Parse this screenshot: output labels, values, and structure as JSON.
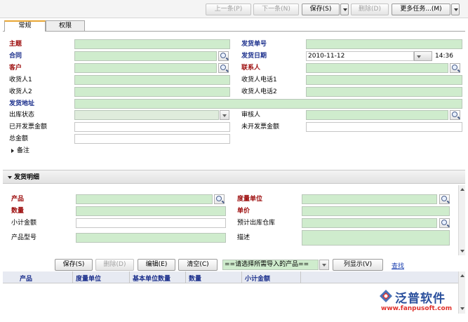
{
  "toolbar": {
    "prev": "上一条(P)",
    "next": "下一条(N)",
    "save": "保存(S)",
    "delete": "删除(D)",
    "more": "更多任务...(M)"
  },
  "tabs": [
    "常规",
    "权限"
  ],
  "form": {
    "subject": "主题",
    "contract": "合同",
    "customer": "客户",
    "receiver1": "收货人1",
    "receiver2": "收货人2",
    "address": "发货地址",
    "out_status": "出库状态",
    "invoiced": "已开发票金额",
    "total": "总金额",
    "remarks": "备注",
    "ship_no": "发货单号",
    "ship_date": "发货日期",
    "ship_date_value": "2010-11-12",
    "ship_time_value": "14:36",
    "contact": "联系人",
    "phone1": "收货人电话1",
    "phone2": "收货人电话2",
    "reviewer": "审核人",
    "uninvoiced": "未开发票金额"
  },
  "detail": {
    "section_title": "发货明细",
    "product": "产品",
    "quantity": "数量",
    "subtotal": "小计金额",
    "model": "产品型号",
    "unit": "度量单位",
    "price": "单价",
    "warehouse": "预计出库仓库",
    "description": "描述"
  },
  "detail_actions": {
    "save": "保存(S)",
    "delete": "删除(D)",
    "edit": "编辑(E)",
    "clear": "清空(C)",
    "product_select": "==请选择所需导入的产品==",
    "columns": "列显示(V)",
    "find": "查找"
  },
  "table": {
    "columns": [
      "产品",
      "度量单位",
      "基本单位数量",
      "数量",
      "小计金额"
    ]
  },
  "logo": {
    "name": "泛普软件",
    "url": "www.fanpusoft.com"
  }
}
